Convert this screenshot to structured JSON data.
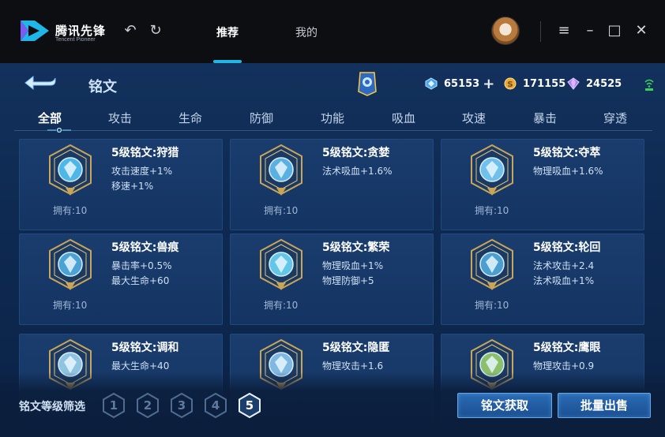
{
  "app": {
    "logo_text": "腾讯先锋",
    "logo_sub": "Tencent Pioneer",
    "nav_tabs": [
      "推荐",
      "我的"
    ],
    "active_tab": "推荐",
    "accent": "#22b8e6"
  },
  "page": {
    "title": "铭文",
    "resources": [
      {
        "icon": "diamond-coupon-icon",
        "value": "65153",
        "has_plus": true
      },
      {
        "icon": "gold-coin-icon",
        "value": "171155",
        "has_plus": false
      },
      {
        "icon": "purple-crystal-icon",
        "value": "24525",
        "has_plus": false
      }
    ],
    "categories": [
      "全部",
      "攻击",
      "生命",
      "防御",
      "功能",
      "吸血",
      "攻速",
      "暴击",
      "穿透"
    ],
    "active_category": "全部"
  },
  "inscriptions": [
    {
      "title": "5级铭文:狩猎",
      "stats": [
        "攻击速度+1%",
        "移速+1%"
      ],
      "owned": "拥有:10",
      "color": "#4fb6e8"
    },
    {
      "title": "5级铭文:贪婪",
      "stats": [
        "法术吸血+1.6%"
      ],
      "owned": "拥有:10",
      "color": "#5ab0e0"
    },
    {
      "title": "5级铭文:夺萃",
      "stats": [
        "物理吸血+1.6%"
      ],
      "owned": "拥有:10",
      "color": "#6fc0ea"
    },
    {
      "title": "5级铭文:兽痕",
      "stats": [
        "暴击率+0.5%",
        "最大生命+60"
      ],
      "owned": "拥有:10",
      "color": "#4aa3d4"
    },
    {
      "title": "5级铭文:繁荣",
      "stats": [
        "物理吸血+1%",
        "物理防御+5"
      ],
      "owned": "拥有:10",
      "color": "#62c6e8"
    },
    {
      "title": "5级铭文:轮回",
      "stats": [
        "法术攻击+2.4",
        "法术吸血+1%"
      ],
      "owned": "拥有:10",
      "color": "#4a9fd0"
    },
    {
      "title": "5级铭文:调和",
      "stats": [
        "最大生命+40"
      ],
      "owned": "",
      "color": "#8fc4e0"
    },
    {
      "title": "5级铭文:隐匿",
      "stats": [
        "物理攻击+1.6"
      ],
      "owned": "",
      "color": "#7fb8e0"
    },
    {
      "title": "5级铭文:鹰眼",
      "stats": [
        "物理攻击+0.9"
      ],
      "owned": "",
      "color": "#8bbf6a"
    }
  ],
  "footer": {
    "filter_label": "铭文等级筛选",
    "levels": [
      "1",
      "2",
      "3",
      "4",
      "5"
    ],
    "active_level": "5",
    "acquire_label": "铭文获取",
    "bulk_sell_label": "批量出售"
  }
}
